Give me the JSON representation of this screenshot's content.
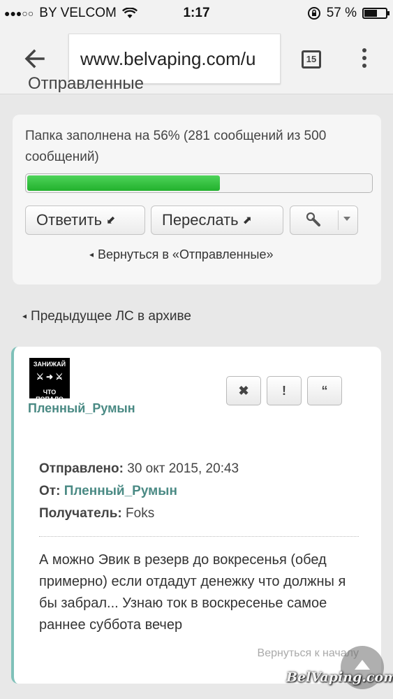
{
  "status_bar": {
    "signal": "●●●○○",
    "carrier": "BY VELCOM",
    "time": "1:17",
    "battery_text": "57 %",
    "battery_level": 0.57
  },
  "browser": {
    "url": "www.belvaping.com/u",
    "tab_count": "15"
  },
  "page": {
    "heading": "Отправленные",
    "quota_text": "Папка заполнена на 56% (281 сообщений из 500 сообщений)",
    "quota_percent": 56,
    "reply_label": "Ответить",
    "forward_label": "Переслать",
    "back_to_folder": "Вернуться в «Отправленные»",
    "prev_pm": "Предыдущее ЛС в архиве"
  },
  "message": {
    "avatar_top": "ЗАНИЖАЙ",
    "avatar_bottom": "ЧТО ПОПАЛО",
    "author": "Пленный_Румын",
    "sent_label": "Отправлено:",
    "sent_value": "30 окт 2015, 20:43",
    "from_label": "От:",
    "from_value": "Пленный_Румын",
    "to_label": "Получатель:",
    "to_value": "Foks",
    "body": "А можно Эвик в резерв до вокресенья (обед примерно) если отдадут денежку что должны я бы забрал... Узнаю ток в воскресенье самое раннее суббота вечер",
    "back_to_top": "Вернуться к началу"
  },
  "watermark": "BelVaping.com",
  "colors": {
    "progress": "#2dbf38",
    "link": "#4a8a84",
    "accent_border": "#7fc1b9"
  }
}
